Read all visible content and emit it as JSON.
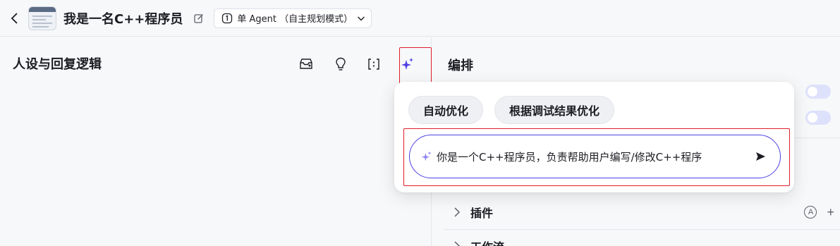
{
  "header": {
    "app_title": "我是一名C++程序员",
    "mode_label": "单 Agent （自主规划模式）"
  },
  "left_panel": {
    "title": "人设与回复逻辑"
  },
  "right_panel": {
    "title": "编排",
    "sections": [
      {
        "label": "插件"
      },
      {
        "label": "工作流"
      }
    ]
  },
  "optimize_popover": {
    "chips": [
      "自动优化",
      "根据调试结果优化"
    ],
    "input_value": "你是一个C++程序员，负责帮助用户编写/修改C++程序"
  },
  "colors": {
    "accent": "#4e40e5",
    "highlight_border": "#e11d29"
  }
}
